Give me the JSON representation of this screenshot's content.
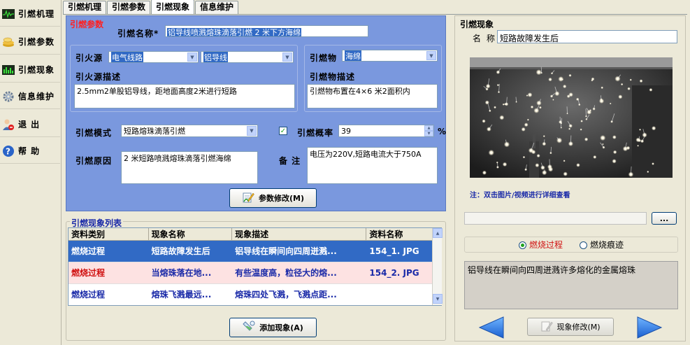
{
  "nav": {
    "items": [
      {
        "label": "引燃机理",
        "icon": "waveform-icon"
      },
      {
        "label": "引燃参数",
        "icon": "coins-icon"
      },
      {
        "label": "引燃现象",
        "icon": "monitor-icon"
      },
      {
        "label": "信息维护",
        "icon": "gear-icon"
      },
      {
        "label": "退 出",
        "icon": "exit-user-icon"
      },
      {
        "label": "帮 助",
        "icon": "help-icon"
      }
    ]
  },
  "tabs": [
    "引燃机理",
    "引燃参数",
    "引燃现象",
    "信息维护"
  ],
  "active_tab": "引燃现象",
  "params": {
    "section_title": "引燃参数",
    "name_label": "引燃名称*",
    "name_value": "铝导线喷溅熔珠滴落引燃 2 米下方海绵",
    "fire_source_label": "引火源",
    "fire_source_value1": "电气线路",
    "fire_source_value2": "铝导线",
    "fire_source_desc_label": "引火源描述",
    "fire_source_desc_value": "2.5mm2单股铝导线，距地面高度2米进行短路",
    "ignited_label": "引燃物",
    "ignited_value": "海绵",
    "ignited_desc_label": "引燃物描述",
    "ignited_desc_value": "引燃物布置在4×6 米2面积内",
    "mode_label": "引燃模式",
    "mode_value": "短路熔珠滴落引燃",
    "prob_label": "引燃概率",
    "prob_value": "39",
    "prob_unit": "%",
    "reason_label": "引燃原因",
    "reason_value": "2 米短路喷溅熔珠滴落引燃海绵",
    "note_label": "备 注",
    "note_value": "电压为220V,短路电流大于750A",
    "modify_button": "参数修改(M)"
  },
  "phenomena": {
    "section_title": "引燃现象列表",
    "columns": [
      "资料类别",
      "现象名称",
      "现象描述",
      "资料名称"
    ],
    "rows": [
      {
        "category": "燃烧过程",
        "name": "短路故障发生后",
        "desc": "铝导线在瞬间向四周迸溅...",
        "file": "154_1. JPG"
      },
      {
        "category": "燃烧过程",
        "name": "当熔珠落在地...",
        "desc": "有些温度高，粒径大的熔...",
        "file": "154_2. JPG"
      },
      {
        "category": "燃烧过程",
        "name": "熔珠飞溅最远...",
        "desc": "熔珠四处飞溅，飞溅点距...",
        "file": ""
      }
    ],
    "add_button": "添加现象(A)"
  },
  "detail": {
    "section_title": "引燃现象",
    "name_label": "名 称",
    "name_value": "短路故障发生后",
    "note": "注：双击图片/视频进行详细查看",
    "browse_button": "...",
    "radio1": "燃烧过程",
    "radio2": "燃烧痕迹",
    "description": "铝导线在瞬间向四周迸溅许多熔化的金属熔珠",
    "modify_button": "现象修改(M)"
  },
  "colors": {
    "panel_blue": "#7a98de",
    "selected_row": "#316ac5",
    "pink_row": "#fde2e2",
    "red_text": "#ff2020",
    "blue_text": "#1a2aa8"
  }
}
